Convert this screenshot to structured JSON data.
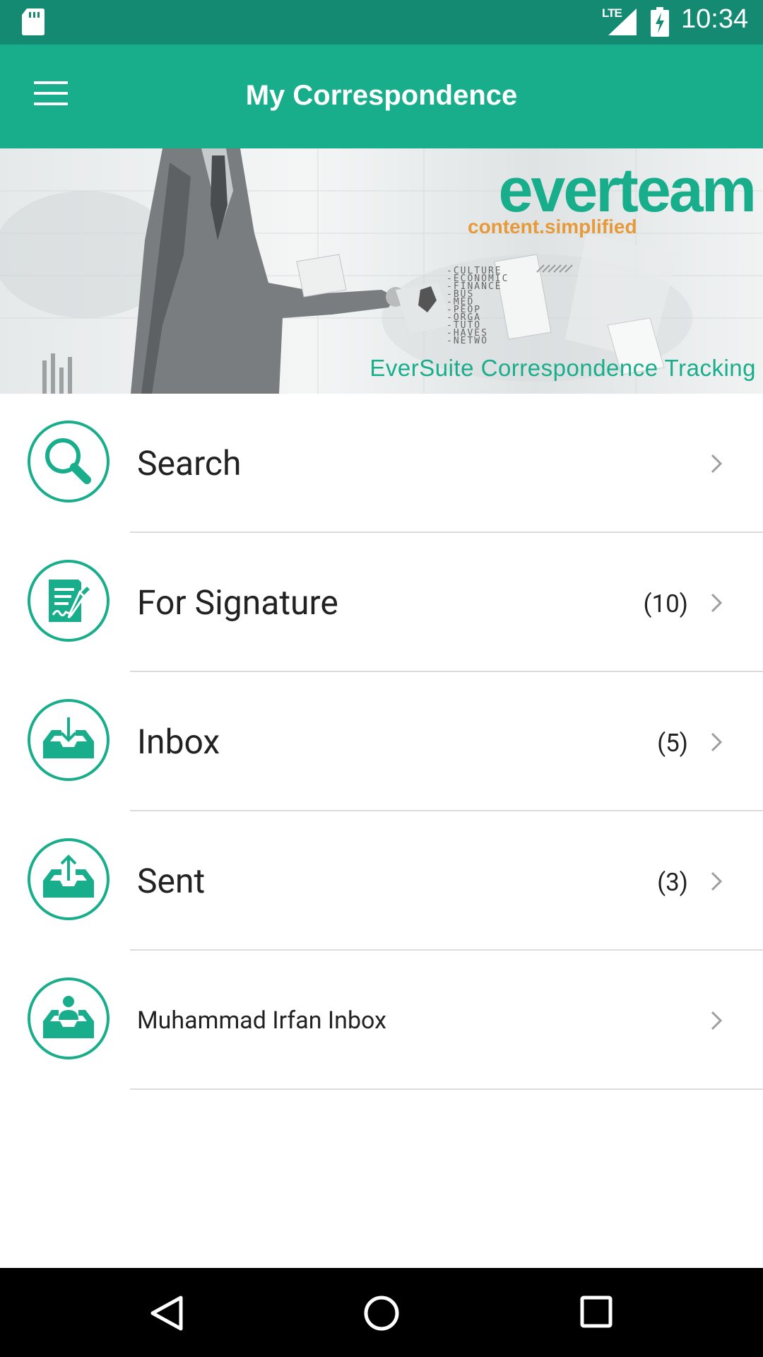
{
  "status_bar": {
    "network": "LTE",
    "time": "10:34",
    "icons": [
      "sd-card-icon",
      "signal-icon",
      "battery-charging-icon"
    ]
  },
  "app_bar": {
    "title": "My Correspondence",
    "menu_icon": "hamburger-menu-icon"
  },
  "banner": {
    "brand": "everteam",
    "brand_subtitle": "content.simplified",
    "tagline": "EverSuite Correspondence Tracking",
    "background_words": [
      "-CULTURE",
      "-ECONOMIC",
      "-FINANCE",
      "-BUS",
      "-MED",
      "-PEOP",
      "-ORGA",
      "-TUTO",
      "-HAVES",
      "-NETWO"
    ]
  },
  "menu": {
    "items": [
      {
        "label": "Search",
        "count": "",
        "icon": "search-icon"
      },
      {
        "label": "For Signature",
        "count": "(10)",
        "icon": "signature-document-icon"
      },
      {
        "label": "Inbox",
        "count": "(5)",
        "icon": "inbox-download-icon"
      },
      {
        "label": "Sent",
        "count": "(3)",
        "icon": "outbox-upload-icon"
      },
      {
        "label": "Muhammad Irfan Inbox",
        "count": "",
        "icon": "user-inbox-icon"
      }
    ]
  },
  "nav_bar": {
    "buttons": [
      "back-triangle-icon",
      "home-circle-icon",
      "recents-square-icon"
    ]
  },
  "colors": {
    "status_bar": "#158a72",
    "accent": "#19ae8b",
    "brand_orange": "#e69a3a",
    "nav_bar": "#000000"
  }
}
